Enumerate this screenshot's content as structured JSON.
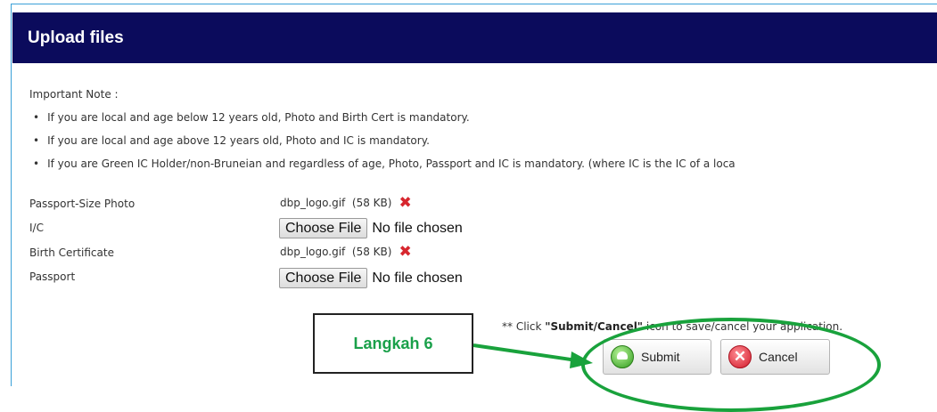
{
  "header": {
    "title": "Upload files"
  },
  "notes": {
    "title": "Important Note :",
    "items": [
      "If you are local and age below 12 years old, Photo and Birth Cert is mandatory.",
      "If you are local and age above 12 years old, Photo and IC is mandatory.",
      "If you are Green IC Holder/non-Bruneian and regardless of age, Photo, Passport and IC is mandatory. (where IC is the IC of a loca"
    ]
  },
  "fields": {
    "photo": {
      "label": "Passport-Size Photo",
      "file": "dbp_logo.gif  (58 KB)"
    },
    "ic": {
      "label": "I/C",
      "button": "Choose File",
      "status": "No file chosen"
    },
    "birth_cert": {
      "label": "Birth Certificate",
      "file": "dbp_logo.gif  (58 KB)"
    },
    "passport": {
      "label": "Passport",
      "button": "Choose File",
      "status": "No file chosen"
    }
  },
  "hint": {
    "prefix": "** Click ",
    "bold": "\"Submit/Cancel\"",
    "suffix": " icon to save/cancel your application."
  },
  "buttons": {
    "submit": "Submit",
    "cancel": "Cancel"
  },
  "annotation": {
    "label": "Langkah 6",
    "highlight_color": "#19a23c"
  },
  "icons": {
    "delete": "red-x-icon",
    "submit": "green-upload-icon",
    "cancel": "red-x-circle-icon"
  }
}
